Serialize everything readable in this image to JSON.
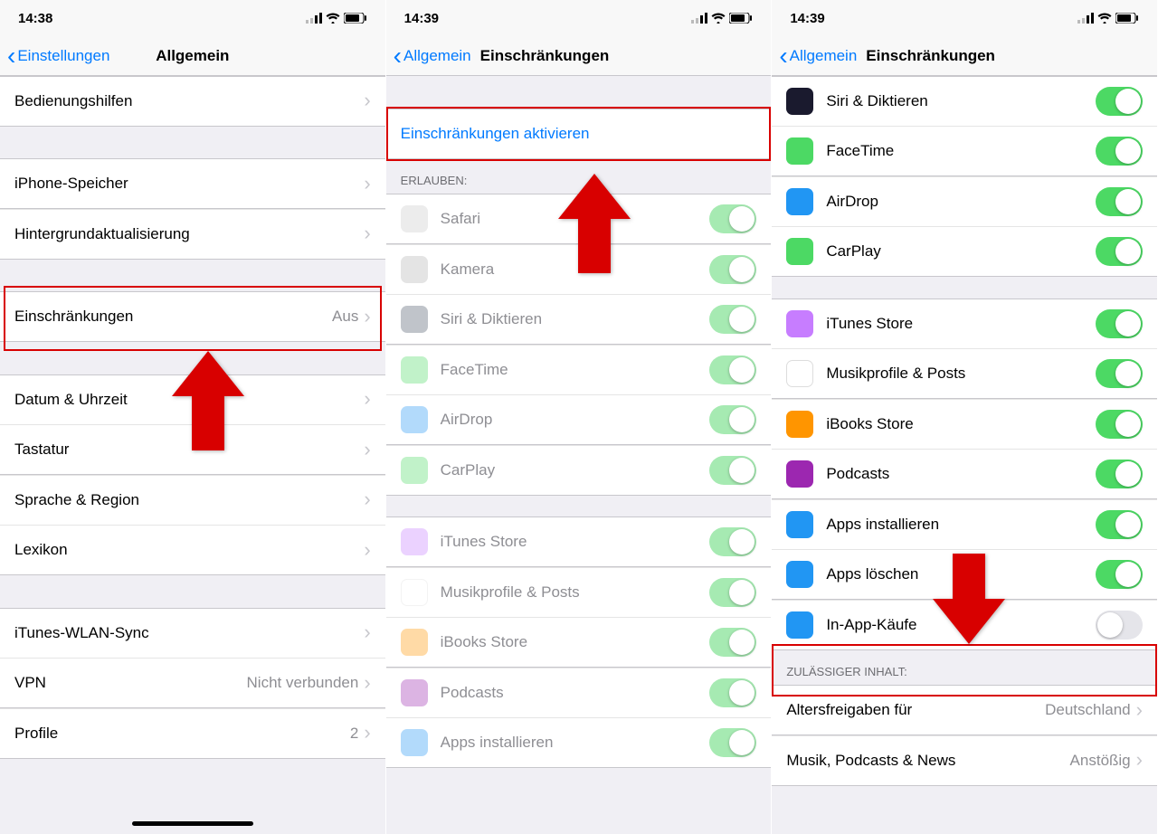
{
  "panel1": {
    "time": "14:38",
    "back": "Einstellungen",
    "title": "Allgemein",
    "rows1": [
      {
        "label": "Bedienungshilfen"
      }
    ],
    "rows2": [
      {
        "label": "iPhone-Speicher"
      },
      {
        "label": "Hintergrundaktualisierung"
      }
    ],
    "rows3": [
      {
        "label": "Einschränkungen",
        "value": "Aus"
      }
    ],
    "rows4": [
      {
        "label": "Datum & Uhrzeit"
      },
      {
        "label": "Tastatur"
      },
      {
        "label": "Sprache & Region"
      },
      {
        "label": "Lexikon"
      }
    ],
    "rows5": [
      {
        "label": "iTunes-WLAN-Sync"
      },
      {
        "label": "VPN",
        "value": "Nicht verbunden"
      },
      {
        "label": "Profile",
        "value": "2"
      }
    ]
  },
  "panel2": {
    "time": "14:39",
    "back": "Allgemein",
    "title": "Einschränkungen",
    "action": "Einschränkungen aktivieren",
    "sectionHeader": "ERLAUBEN:",
    "apps1": [
      {
        "label": "Safari",
        "color": "#c9c9c9"
      },
      {
        "label": "Kamera",
        "color": "#b3b3b3"
      },
      {
        "label": "Siri & Diktieren",
        "color": "#4a5568"
      },
      {
        "label": "FaceTime",
        "color": "#4cd964"
      },
      {
        "label": "AirDrop",
        "color": "#2196f3"
      },
      {
        "label": "CarPlay",
        "color": "#4cd964"
      }
    ],
    "apps2": [
      {
        "label": "iTunes Store",
        "color": "#c77dff"
      },
      {
        "label": "Musikprofile & Posts",
        "color": "#fff"
      },
      {
        "label": "iBooks Store",
        "color": "#ff9500"
      },
      {
        "label": "Podcasts",
        "color": "#9c27b0"
      },
      {
        "label": "Apps installieren",
        "color": "#2196f3"
      }
    ]
  },
  "panel3": {
    "time": "14:39",
    "back": "Allgemein",
    "title": "Einschränkungen",
    "apps1": [
      {
        "label": "Siri & Diktieren",
        "color": "#1a1a2e",
        "on": true
      },
      {
        "label": "FaceTime",
        "color": "#4cd964",
        "on": true
      },
      {
        "label": "AirDrop",
        "color": "#2196f3",
        "on": true
      },
      {
        "label": "CarPlay",
        "color": "#4cd964",
        "on": true
      }
    ],
    "apps2": [
      {
        "label": "iTunes Store",
        "color": "#c77dff",
        "on": true
      },
      {
        "label": "Musikprofile & Posts",
        "color": "#fff",
        "on": true
      },
      {
        "label": "iBooks Store",
        "color": "#ff9500",
        "on": true
      },
      {
        "label": "Podcasts",
        "color": "#9c27b0",
        "on": true
      },
      {
        "label": "Apps installieren",
        "color": "#2196f3",
        "on": true
      },
      {
        "label": "Apps löschen",
        "color": "#2196f3",
        "on": true
      },
      {
        "label": "In-App-Käufe",
        "color": "#2196f3",
        "on": false
      }
    ],
    "sectionHeader": "ZULÄSSIGER INHALT:",
    "rows3": [
      {
        "label": "Altersfreigaben für",
        "value": "Deutschland"
      },
      {
        "label": "Musik, Podcasts & News",
        "value": "Anstößig"
      }
    ]
  }
}
